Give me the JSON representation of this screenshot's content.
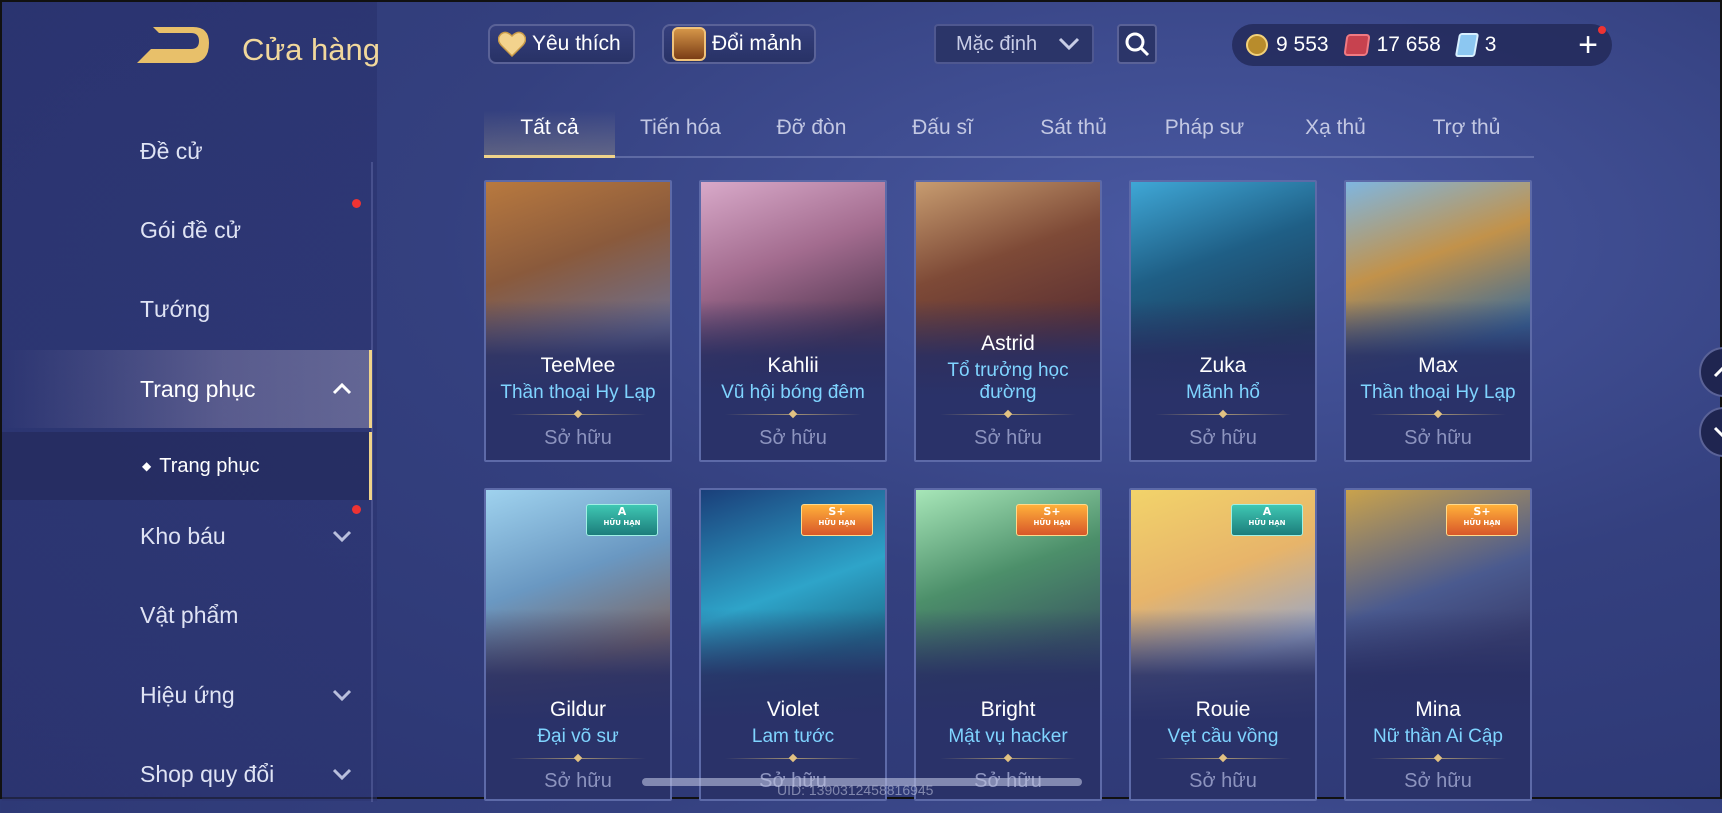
{
  "header": {
    "title": "Cửa hàng"
  },
  "buttons": {
    "favorites": "Yêu thích",
    "exchange": "Đổi mảnh"
  },
  "sort": {
    "value": "Mặc định"
  },
  "currency": {
    "gold": "9 553",
    "gems": "17 658",
    "tickets": "3",
    "add": "+"
  },
  "tabs": [
    "Tất cả",
    "Tiến hóa",
    "Đỡ đòn",
    "Đấu sĩ",
    "Sát thủ",
    "Pháp sư",
    "Xạ thủ",
    "Trợ thủ"
  ],
  "sidebar": {
    "items": [
      "Đề cử",
      "Gói đề cử",
      "Tướng",
      "Trang phục",
      "Kho báu",
      "Vật phẩm",
      "Hiệu ứng",
      "Shop quy đổi"
    ],
    "sub": "Trang phục"
  },
  "cards": [
    {
      "hero": "TeeMee",
      "skin": "Thần thoại Hy Lạp",
      "status": "Sở hữu"
    },
    {
      "hero": "Kahlii",
      "skin": "Vũ hội bóng đêm",
      "status": "Sở hữu"
    },
    {
      "hero": "Astrid",
      "skin": "Tổ trưởng học đường",
      "status": "Sở hữu"
    },
    {
      "hero": "Zuka",
      "skin": "Mãnh hổ",
      "status": "Sở hữu"
    },
    {
      "hero": "Max",
      "skin": "Thần thoại Hy Lạp",
      "status": "Sở hữu"
    },
    {
      "hero": "Gildur",
      "skin": "Đại võ sư",
      "status": "Sở hữu",
      "badge": "A",
      "badge_sub": "HỮU HẠN"
    },
    {
      "hero": "Violet",
      "skin": "Lam tước",
      "status": "Sở hữu",
      "badge": "S+",
      "badge_sub": "HỮU HẠN"
    },
    {
      "hero": "Bright",
      "skin": "Mật vụ hacker",
      "status": "Sở hữu",
      "badge": "S+",
      "badge_sub": "HỮU HẠN"
    },
    {
      "hero": "Rouie",
      "skin": "Vẹt cầu vồng",
      "status": "Sở hữu",
      "badge": "A",
      "badge_sub": "HỮU HẠN"
    },
    {
      "hero": "Mina",
      "skin": "Nữ thần Ai Cập",
      "status": "Sở hữu",
      "badge": "S+",
      "badge_sub": "HỮU HẠN"
    }
  ],
  "footer": {
    "uid": "UID: 1390312458816945"
  },
  "colors": {
    "accent_gold": "#f0d48a",
    "skin_name_blue": "#7fd4ff",
    "notification_red": "#e33333"
  }
}
